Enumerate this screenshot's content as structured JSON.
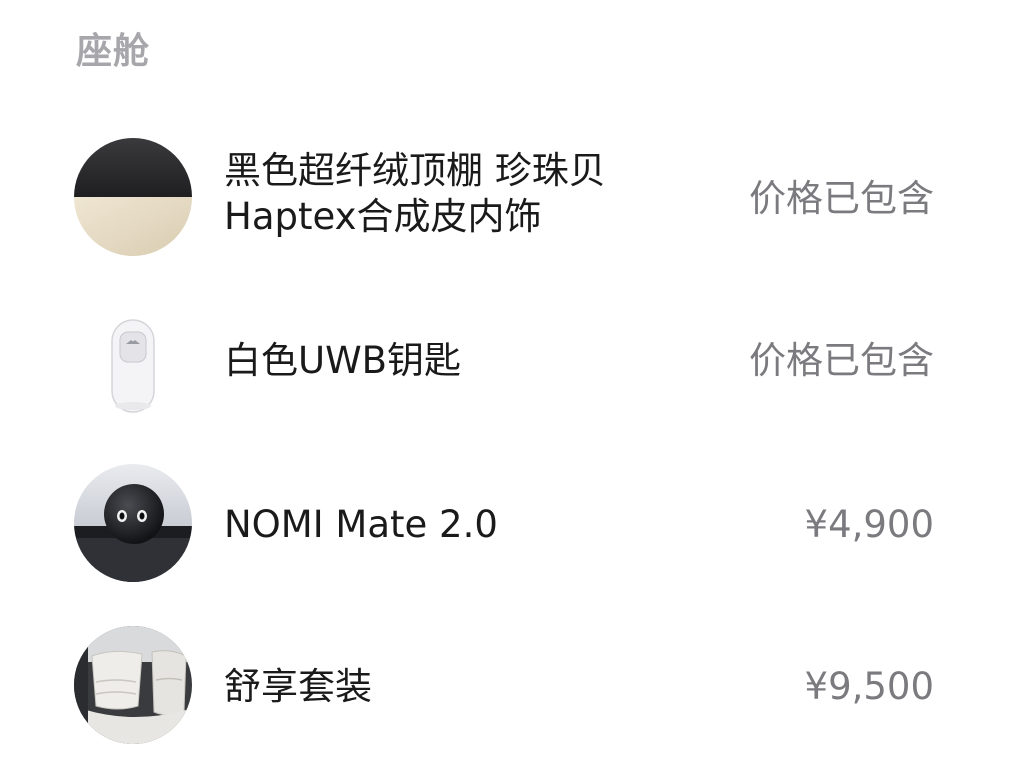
{
  "section": {
    "title": "座舱"
  },
  "items": [
    {
      "name": "黑色超纤绒顶棚 珍珠贝\nHaptex合成皮内饰",
      "price": "价格已包含",
      "thumbnail": "interior-color-swatch"
    },
    {
      "name": "白色UWB钥匙",
      "price": "价格已包含",
      "thumbnail": "uwb-key-fob"
    },
    {
      "name": "NOMI Mate 2.0",
      "price": "¥4,900",
      "thumbnail": "nomi-mate-robot"
    },
    {
      "name": "舒享套装",
      "price": "¥9,500",
      "thumbnail": "comfort-seats"
    }
  ],
  "colors": {
    "section_title": "#a6a6ab",
    "item_name": "#1a1a1a",
    "item_price": "#7a7a7f",
    "swatch_top": "#2a2a2c",
    "swatch_bottom": "#e6dcc6"
  }
}
